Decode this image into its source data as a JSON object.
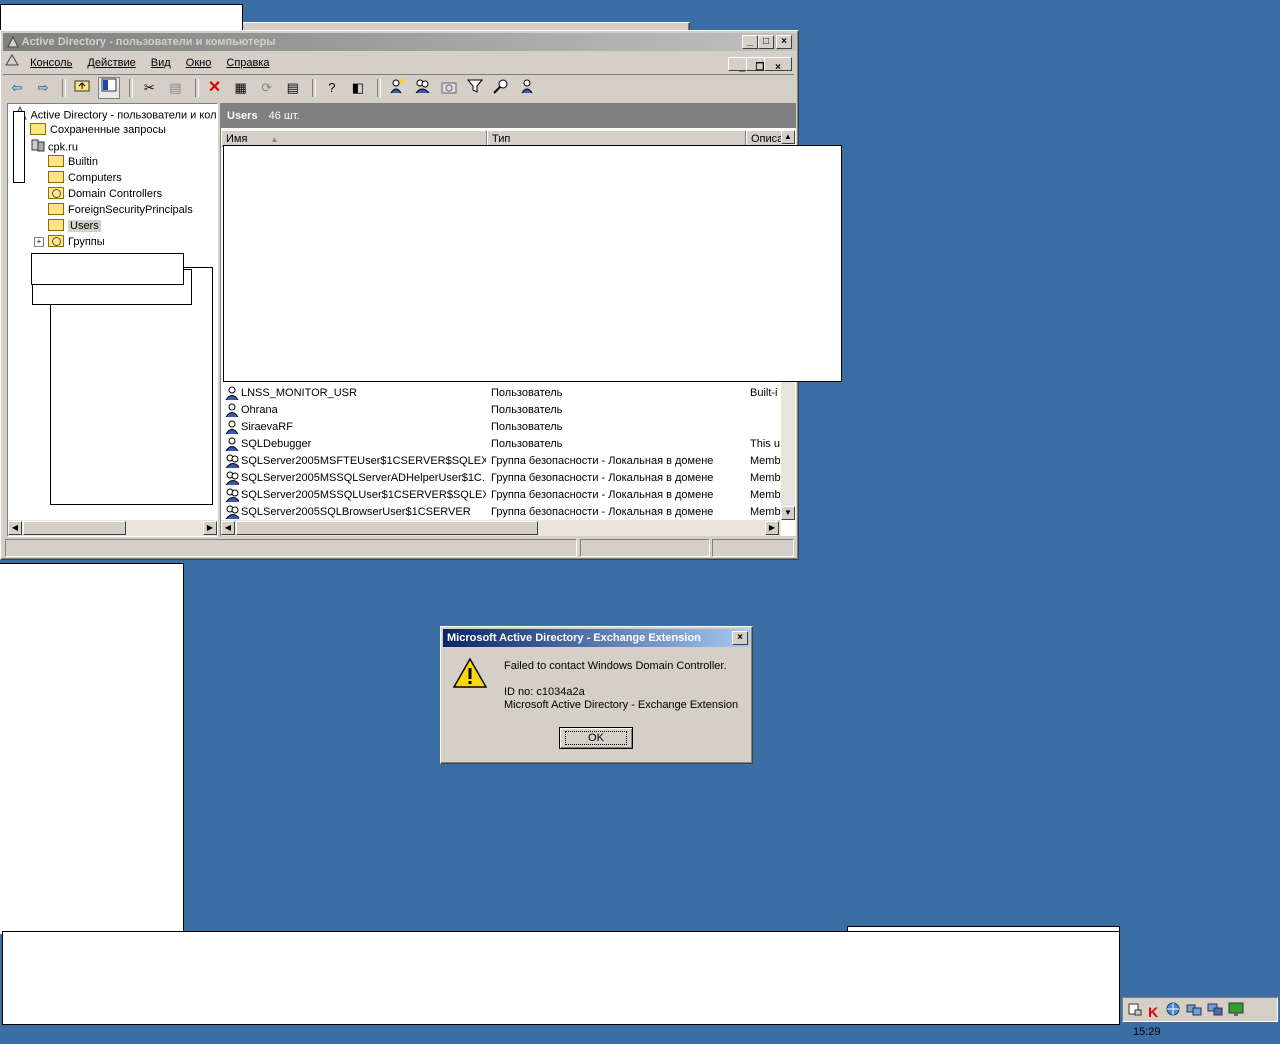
{
  "main_window": {
    "title": "Active Directory - пользователи и компьютеры",
    "menu": [
      "Консоль",
      "Действие",
      "Вид",
      "Окно",
      "Справка"
    ]
  },
  "tree": {
    "root": "Active Directory - пользователи и кол",
    "saved_queries": "Сохраненные запросы",
    "domain": "cpk.ru",
    "children": [
      "Builtin",
      "Computers",
      "Domain Controllers",
      "ForeignSecurityPrincipals",
      "Users",
      "Группы"
    ]
  },
  "list_pane": {
    "header_title": "Users",
    "header_count": "46 шт.",
    "columns": [
      "Имя",
      "Тип",
      "Описа"
    ],
    "rows": [
      {
        "name": "LNSS_MONITOR_USR",
        "type": "Пользователь",
        "desc": "Built-i",
        "icon": "user-icon"
      },
      {
        "name": "Ohrana",
        "type": "Пользователь",
        "desc": "",
        "icon": "user-icon"
      },
      {
        "name": "SiraevaRF",
        "type": "Пользователь",
        "desc": "",
        "icon": "user-icon"
      },
      {
        "name": "SQLDebugger",
        "type": "Пользователь",
        "desc": "This u",
        "icon": "user-icon"
      },
      {
        "name": "SQLServer2005MSFTEUser$1CSERVER$SQLEXP...",
        "type": "Группа безопасности - Локальная в домене",
        "desc": "Memb",
        "icon": "group-icon"
      },
      {
        "name": "SQLServer2005MSSQLServerADHelperUser$1C...",
        "type": "Группа безопасности - Локальная в домене",
        "desc": "Memb",
        "icon": "group-icon"
      },
      {
        "name": "SQLServer2005MSSQLUser$1CSERVER$SQLEX...",
        "type": "Группа безопасности - Локальная в домене",
        "desc": "Memb",
        "icon": "group-icon"
      },
      {
        "name": "SQLServer2005SQLBrowserUser$1CSERVER",
        "type": "Группа безопасности - Локальная в домене",
        "desc": "Memb",
        "icon": "group-icon"
      }
    ]
  },
  "dialog": {
    "title": "Microsoft Active Directory - Exchange Extension",
    "message": "Failed to contact Windows Domain Controller.",
    "id_line": "ID no: c1034a2a",
    "source_line": "Microsoft Active Directory - Exchange Extension",
    "ok_label": "OK",
    "icon": "warning-icon"
  },
  "taskbar": {
    "clock": "15:29",
    "tray_icons": [
      "network-icon",
      "antivirus-icon",
      "lan-icon",
      "lan-icon",
      "monitor-icon",
      "display-icon"
    ]
  },
  "colors": {
    "desktop": "#3a6ea5",
    "window_face": "#d4d0c8",
    "dialog_title": "#0a246a"
  }
}
